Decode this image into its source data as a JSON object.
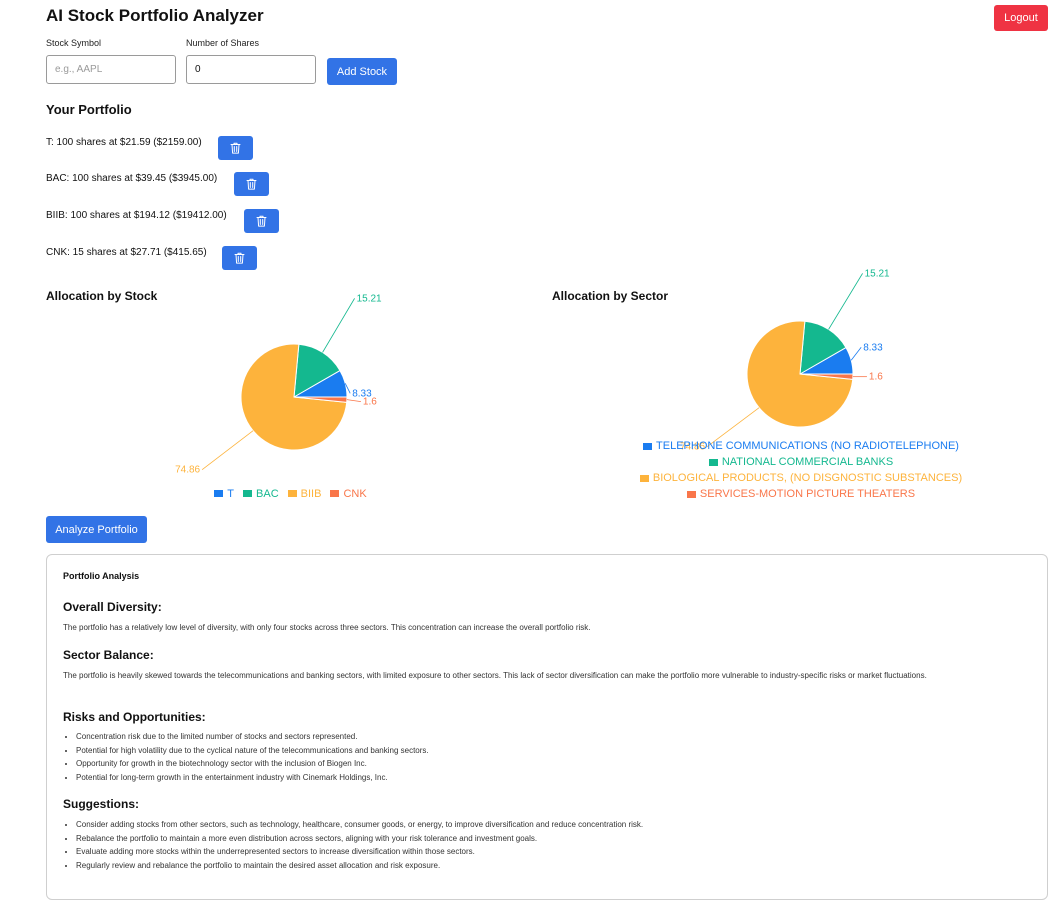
{
  "app": {
    "title": "AI Stock Portfolio Analyzer",
    "logout_label": "Logout"
  },
  "colors": {
    "primary": "#3273e6",
    "danger": "#ef3343",
    "T": "#1a7cf0",
    "BAC": "#14b88f",
    "BIIB": "#fdb33c",
    "CNK": "#f9764a"
  },
  "form": {
    "symbol_label": "Stock Symbol",
    "symbol_placeholder": "e.g., AAPL",
    "symbol_value": "",
    "shares_label": "Number of Shares",
    "shares_value": "0",
    "add_label": "Add Stock"
  },
  "portfolio": {
    "heading": "Your Portfolio",
    "items": [
      {
        "text": "T: 100 shares at $21.59 ($2159.00)",
        "delete_icon": "trash-icon"
      },
      {
        "text": "BAC: 100 shares at $39.45 ($3945.00)",
        "delete_icon": "trash-icon"
      },
      {
        "text": "BIIB: 100 shares at $194.12 ($19412.00)",
        "delete_icon": "trash-icon"
      },
      {
        "text": "CNK: 15 shares at $27.71 ($415.65)",
        "delete_icon": "trash-icon"
      }
    ]
  },
  "chart_data": [
    {
      "type": "pie",
      "title": "Allocation by Stock",
      "labels": [
        "T",
        "BAC",
        "BIIB",
        "CNK"
      ],
      "values": [
        8.33,
        15.21,
        74.86,
        1.6
      ],
      "colors": [
        "#1a7cf0",
        "#14b88f",
        "#fdb33c",
        "#f9764a"
      ],
      "legend": "bottom"
    },
    {
      "type": "pie",
      "title": "Allocation by Sector",
      "labels": [
        "TELEPHONE COMMUNICATIONS (NO RADIOTELEPHONE)",
        "NATIONAL COMMERCIAL BANKS",
        "BIOLOGICAL PRODUCTS, (NO DISGNOSTIC SUBSTANCES)",
        "SERVICES-MOTION PICTURE THEATERS"
      ],
      "values": [
        8.33,
        15.21,
        74.86,
        1.6
      ],
      "colors": [
        "#1a7cf0",
        "#14b88f",
        "#fdb33c",
        "#f9764a"
      ],
      "legend": "bottom"
    }
  ],
  "analyze": {
    "label": "Analyze Portfolio"
  },
  "analysis": {
    "title": "Portfolio Analysis",
    "diversity": {
      "heading": "Overall Diversity:",
      "text": "The portfolio has a relatively low level of diversity, with only four stocks across three sectors. This concentration can increase the overall portfolio risk."
    },
    "sector": {
      "heading": "Sector Balance:",
      "text": "The portfolio is heavily skewed towards the telecommunications and banking sectors, with limited exposure to other sectors. This lack of sector diversification can make the portfolio more vulnerable to industry-specific risks or market fluctuations."
    },
    "risks": {
      "heading": "Risks and Opportunities:",
      "items": [
        "Concentration risk due to the limited number of stocks and sectors represented.",
        "Potential for high volatility due to the cyclical nature of the telecommunications and banking sectors.",
        "Opportunity for growth in the biotechnology sector with the inclusion of Biogen Inc.",
        "Potential for long-term growth in the entertainment industry with Cinemark Holdings, Inc."
      ]
    },
    "suggestions": {
      "heading": "Suggestions:",
      "items": [
        "Consider adding stocks from other sectors, such as technology, healthcare, consumer goods, or energy, to improve diversification and reduce concentration risk.",
        "Rebalance the portfolio to maintain a more even distribution across sectors, aligning with your risk tolerance and investment goals.",
        "Evaluate adding more stocks within the underrepresented sectors to increase diversification within those sectors.",
        "Regularly review and rebalance the portfolio to maintain the desired asset allocation and risk exposure."
      ]
    }
  }
}
